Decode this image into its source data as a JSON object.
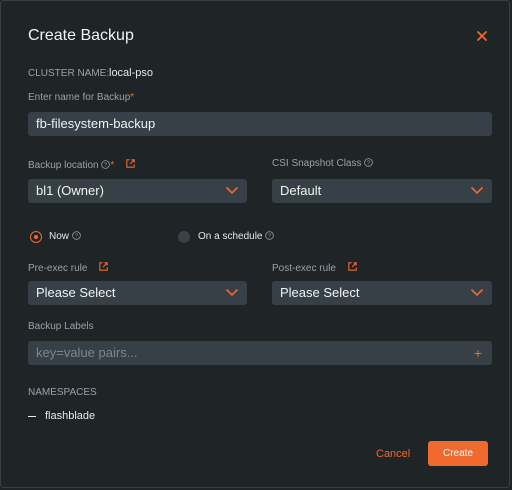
{
  "dialog": {
    "title": "Create Backup",
    "close_icon": "close-icon"
  },
  "cluster": {
    "label": "CLUSTER NAME:",
    "value": "local-pso"
  },
  "backup_name": {
    "label": "Enter name for Backup",
    "required_mark": "*",
    "value": "fb-filesystem-backup"
  },
  "backup_location": {
    "label": "Backup location",
    "required_mark": "*",
    "value": "bl1 (Owner)"
  },
  "csi_snapshot": {
    "label": "CSI Snapshot Class",
    "value": "Default"
  },
  "schedule": {
    "now_label": "Now",
    "schedule_label": "On a schedule",
    "selected": "Now"
  },
  "pre_exec": {
    "label": "Pre-exec rule",
    "value": "Please Select"
  },
  "post_exec": {
    "label": "Post-exec rule",
    "value": "Please Select"
  },
  "labels": {
    "label": "Backup Labels",
    "placeholder": "key=value pairs...",
    "add_symbol": "+"
  },
  "namespaces": {
    "heading": "NAMESPACES",
    "items": [
      "flashblade"
    ]
  },
  "actions": {
    "cancel": "Cancel",
    "create": "Create"
  },
  "colors": {
    "accent": "#f0692f",
    "background": "#1f2427",
    "field": "#364046"
  }
}
